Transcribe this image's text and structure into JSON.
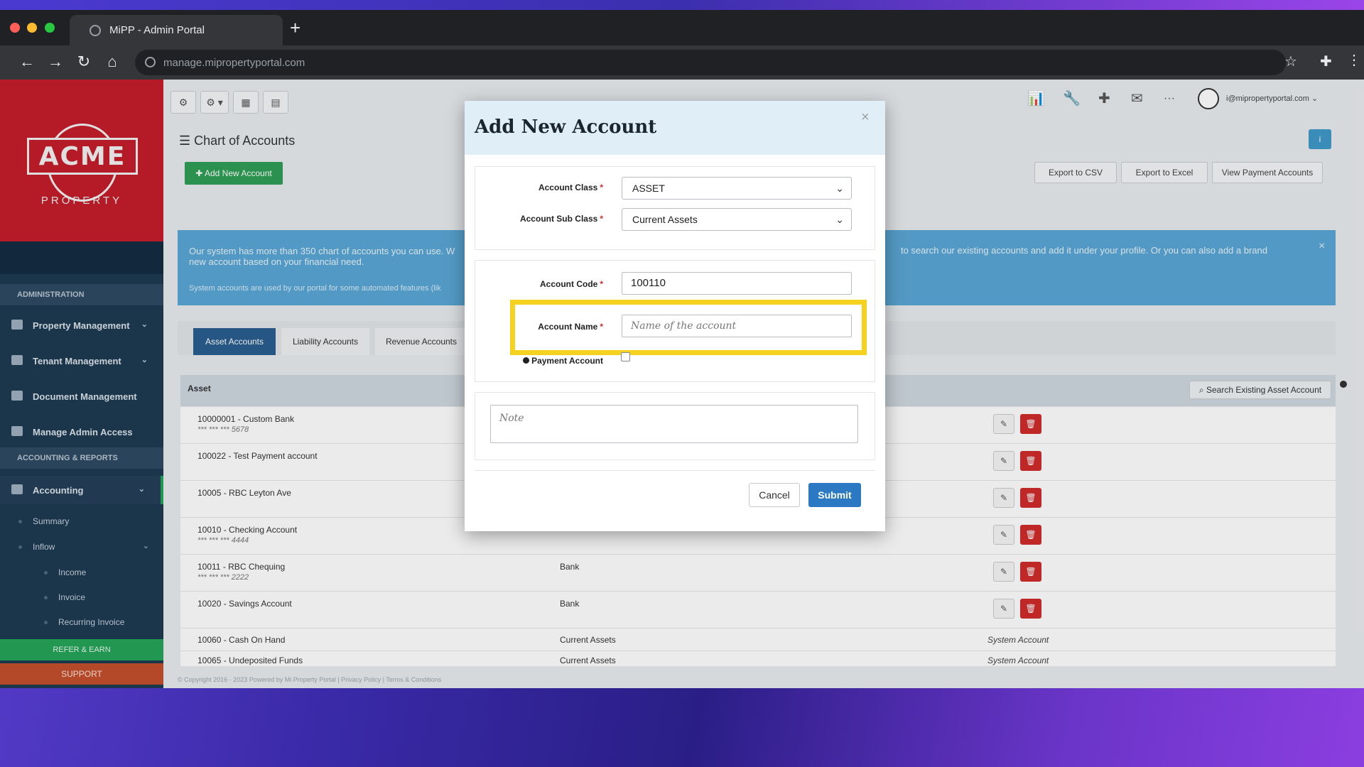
{
  "browser": {
    "tab_title": "MiPP - Admin Portal",
    "new_tab": "+",
    "url": "manage.mipropertyportal.com",
    "back": "←",
    "forward": "→",
    "reload": "↻",
    "home": "⌂",
    "star": "☆",
    "ext": "✚",
    "menu": "⋮"
  },
  "sidebar": {
    "logo_text": "ACME",
    "logo_sub": "PROPERTY",
    "sections": {
      "administration": "ADMINISTRATION",
      "accounting": "ACCOUNTING & REPORTS"
    },
    "items": [
      {
        "label": "Property Management",
        "icon": "building-icon",
        "chev": "⌄"
      },
      {
        "label": "Tenant Management",
        "icon": "users-icon",
        "chev": "⌄"
      },
      {
        "label": "Document Management",
        "icon": "documents-icon"
      },
      {
        "label": "Manage Admin Access",
        "icon": "key-icon"
      },
      {
        "label": "Accounting",
        "icon": "money-icon",
        "chev": "⌄"
      }
    ],
    "sub_items": {
      "summary": "Summary",
      "inflow": "Inflow",
      "income": "Income",
      "invoice": "Invoice",
      "recurring_invoice": "Recurring Invoice"
    },
    "refer": "REFER & EARN",
    "support": "SUPPORT"
  },
  "topbar": {
    "tools": [
      "⚙",
      "⚙ ▾",
      "▦",
      "▤"
    ],
    "icons": {
      "chart": "📊",
      "wrench": "🔧",
      "plus": "✚",
      "mail": "✉",
      "more": "···"
    },
    "user_email": "i@mipropertyportal.com ⌄"
  },
  "page": {
    "title": "Chart of Accounts",
    "title_icon": "☰",
    "info": "i",
    "add_new_account": "✚ Add New Account",
    "export_csv": "Export to CSV",
    "export_excel": "Export to Excel",
    "view_payment_accounts": "View Payment Accounts",
    "alert_left": "Our system has more than 350 chart of accounts you can use. W",
    "alert_left_2": "new account based on your financial need.",
    "alert_right": "to search our existing accounts and add it under your profile. Or you can also add a brand",
    "alert_line2": "System accounts are used by our portal for some automated features (lik",
    "alert_close": "×",
    "tabs": [
      "Asset Accounts",
      "Liability Accounts",
      "Revenue Accounts"
    ],
    "table_header": "Asset",
    "search_existing": "Search Existing Asset Account",
    "rows": [
      {
        "name": "10000001 - Custom Bank",
        "masked": "*** *** *** 5678",
        "class": "",
        "note": ""
      },
      {
        "name": "100022 - Test Payment account",
        "masked": "",
        "class": "",
        "note": ""
      },
      {
        "name": "10005 - RBC Leyton Ave",
        "masked": "",
        "class": "",
        "note": ""
      },
      {
        "name": "10010 - Checking Account",
        "masked": "*** *** *** 4444",
        "class": "",
        "note": ""
      },
      {
        "name": "10011 - RBC Chequing",
        "masked": "*** *** *** 2222",
        "class": "Bank",
        "note": ""
      },
      {
        "name": "10020 - Savings Account",
        "masked": "",
        "class": "Bank",
        "note": ""
      },
      {
        "name": "10060 - Cash On Hand",
        "masked": "",
        "class": "Current Assets",
        "note": "System Account"
      },
      {
        "name": "10065 - Undeposited Funds",
        "masked": "",
        "class": "Current Assets",
        "note": "System Account"
      }
    ],
    "footer": "© Copyright 2016 - 2023 Powered by Mi Property Portal | Privacy Policy | Terms & Conditions"
  },
  "modal": {
    "title": "Add New Account",
    "close": "×",
    "account_class_label": "Account Class",
    "account_class_value": "ASSET",
    "account_sub_class_label": "Account Sub Class",
    "account_sub_class_value": "Current Assets",
    "account_code_label": "Account Code",
    "account_code_value": "100110",
    "account_name_label": "Account Name",
    "account_name_placeholder": "Name of the account",
    "payment_account_label": "Payment Account",
    "note_placeholder": "Note",
    "required_mark": "*",
    "select_arrow": "⌄",
    "cancel": "Cancel",
    "submit": "Submit"
  },
  "colors": {
    "highlight": "#f4d21f",
    "submit": "#2b79c2",
    "add_button": "#2f9e55",
    "delete": "#d12c2c"
  }
}
